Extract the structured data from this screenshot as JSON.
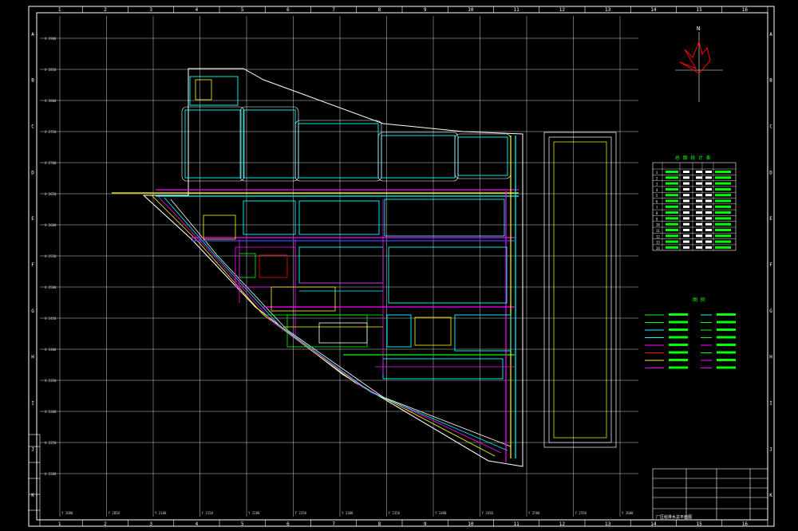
{
  "colors": {
    "background": "#000000",
    "frame": "#ffffff",
    "grid": "#ffffff",
    "road": "#ffffff",
    "cyan": "#00ffff",
    "green": "#00ff00",
    "magenta": "#ff00ff",
    "yellow": "#ffff00",
    "blue": "#4040ff",
    "red": "#ff0000"
  },
  "frame": {
    "top_ruler": [
      "1",
      "2",
      "3",
      "4",
      "5",
      "6",
      "7",
      "8",
      "9",
      "10",
      "11",
      "12",
      "13",
      "14",
      "15",
      "16"
    ],
    "bottom_ruler": [
      "1",
      "2",
      "3",
      "4",
      "5",
      "6",
      "7",
      "8",
      "9",
      "10",
      "11",
      "12",
      "13",
      "14",
      "15",
      "16"
    ],
    "left_ruler": [
      "A",
      "B",
      "C",
      "D",
      "E",
      "F",
      "G",
      "H",
      "I",
      "J",
      "K"
    ],
    "right_ruler": [
      "A",
      "B",
      "C",
      "D",
      "E",
      "F",
      "G",
      "H",
      "I",
      "J",
      "K"
    ]
  },
  "grid_labels": {
    "y_axis": [
      "X 2900",
      "X 2850",
      "X 2800",
      "X 2750",
      "X 2700",
      "X 2650",
      "X 2600",
      "X 2550",
      "X 2500",
      "X 2450",
      "X 2400",
      "X 2350",
      "X 2300",
      "X 2250",
      "X 2200"
    ],
    "x_axis": [
      "Y 2000",
      "Y 2050",
      "Y 2100",
      "Y 2150",
      "Y 2200",
      "Y 2250",
      "Y 2300",
      "Y 2350",
      "Y 2400",
      "Y 2450",
      "Y 2500",
      "Y 2550",
      "Y 2600"
    ]
  },
  "compass": {
    "north": "N"
  },
  "table": {
    "title": "总 图 统 计 表",
    "row_numbers": [
      "1",
      "2",
      "3",
      "4",
      "5",
      "6",
      "7",
      "8",
      "9",
      "10",
      "11",
      "12",
      "13",
      "14"
    ]
  },
  "legend": {
    "title": "图 例"
  },
  "drawing_title": "厂区给排水总平面图"
}
